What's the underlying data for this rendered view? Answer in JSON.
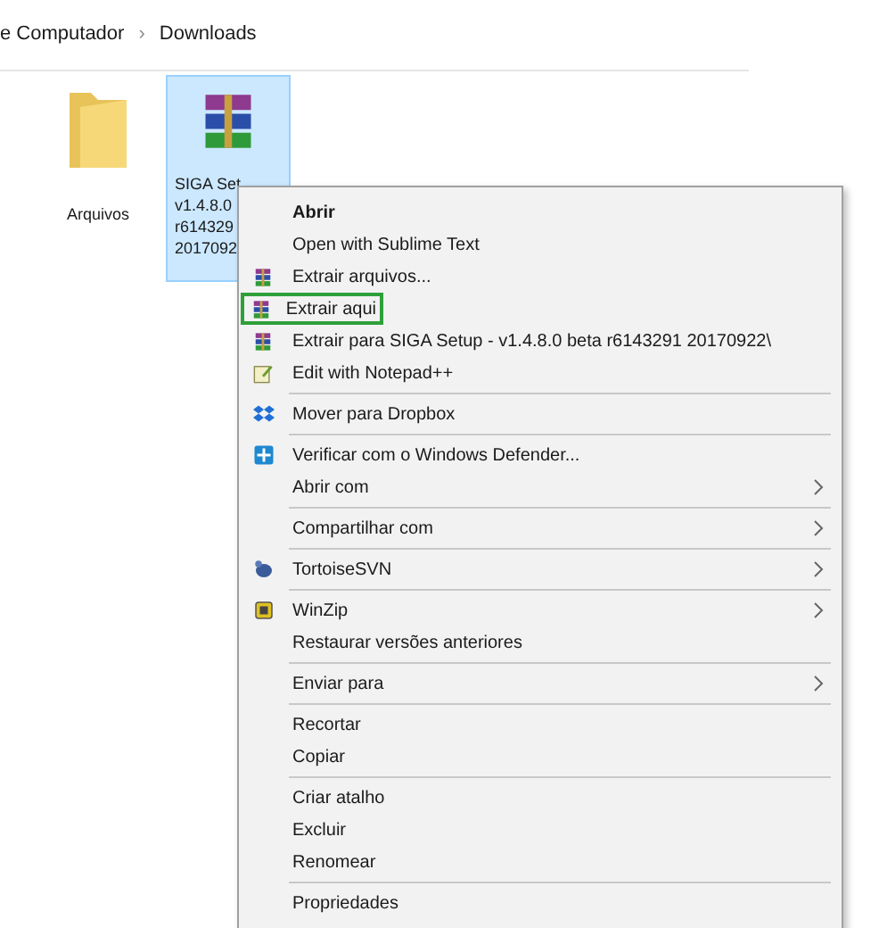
{
  "breadcrumb": {
    "items": [
      "e Computador",
      "Downloads"
    ],
    "separator": "›"
  },
  "files": [
    {
      "kind": "folder",
      "label": [
        "Arquivos"
      ],
      "selected": false
    },
    {
      "kind": "archive",
      "label": [
        "SIGA Set",
        "v1.4.8.0",
        "r614329",
        "2017092"
      ],
      "selected": true
    }
  ],
  "context_menu": {
    "items": [
      {
        "kind": "item",
        "label": "Abrir",
        "bold": true,
        "submenu": false,
        "highlighted": false
      },
      {
        "kind": "item",
        "label": "Open with Sublime Text",
        "bold": false,
        "submenu": false,
        "highlighted": false
      },
      {
        "kind": "archive",
        "label": "Extrair arquivos...",
        "bold": false,
        "submenu": false,
        "highlighted": false
      },
      {
        "kind": "archive",
        "label": "Extrair aqui",
        "bold": false,
        "submenu": false,
        "highlighted": true
      },
      {
        "kind": "archive",
        "label": "Extrair para SIGA Setup - v1.4.8.0 beta r6143291 20170922\\",
        "bold": false,
        "submenu": false,
        "highlighted": false
      },
      {
        "kind": "notepad",
        "label": "Edit with Notepad++",
        "bold": false,
        "submenu": false,
        "highlighted": false
      },
      {
        "kind": "separator"
      },
      {
        "kind": "dropbox",
        "label": "Mover para Dropbox",
        "bold": false,
        "submenu": false,
        "highlighted": false
      },
      {
        "kind": "separator"
      },
      {
        "kind": "defender",
        "label": "Verificar com o Windows Defender...",
        "bold": false,
        "submenu": false,
        "highlighted": false
      },
      {
        "kind": "item",
        "label": "Abrir com",
        "bold": false,
        "submenu": true,
        "highlighted": false
      },
      {
        "kind": "separator"
      },
      {
        "kind": "item",
        "label": "Compartilhar com",
        "bold": false,
        "submenu": true,
        "highlighted": false
      },
      {
        "kind": "separator"
      },
      {
        "kind": "tortoise",
        "label": "TortoiseSVN",
        "bold": false,
        "submenu": true,
        "highlighted": false
      },
      {
        "kind": "separator"
      },
      {
        "kind": "winzip",
        "label": "WinZip",
        "bold": false,
        "submenu": true,
        "highlighted": false
      },
      {
        "kind": "item",
        "label": "Restaurar versões anteriores",
        "bold": false,
        "submenu": false,
        "highlighted": false
      },
      {
        "kind": "separator"
      },
      {
        "kind": "item",
        "label": "Enviar para",
        "bold": false,
        "submenu": true,
        "highlighted": false
      },
      {
        "kind": "separator"
      },
      {
        "kind": "item",
        "label": "Recortar",
        "bold": false,
        "submenu": false,
        "highlighted": false
      },
      {
        "kind": "item",
        "label": "Copiar",
        "bold": false,
        "submenu": false,
        "highlighted": false
      },
      {
        "kind": "separator"
      },
      {
        "kind": "item",
        "label": "Criar atalho",
        "bold": false,
        "submenu": false,
        "highlighted": false
      },
      {
        "kind": "item",
        "label": "Excluir",
        "bold": false,
        "submenu": false,
        "highlighted": false
      },
      {
        "kind": "item",
        "label": "Renomear",
        "bold": false,
        "submenu": false,
        "highlighted": false
      },
      {
        "kind": "separator"
      },
      {
        "kind": "item",
        "label": "Propriedades",
        "bold": false,
        "submenu": false,
        "highlighted": false
      }
    ]
  }
}
